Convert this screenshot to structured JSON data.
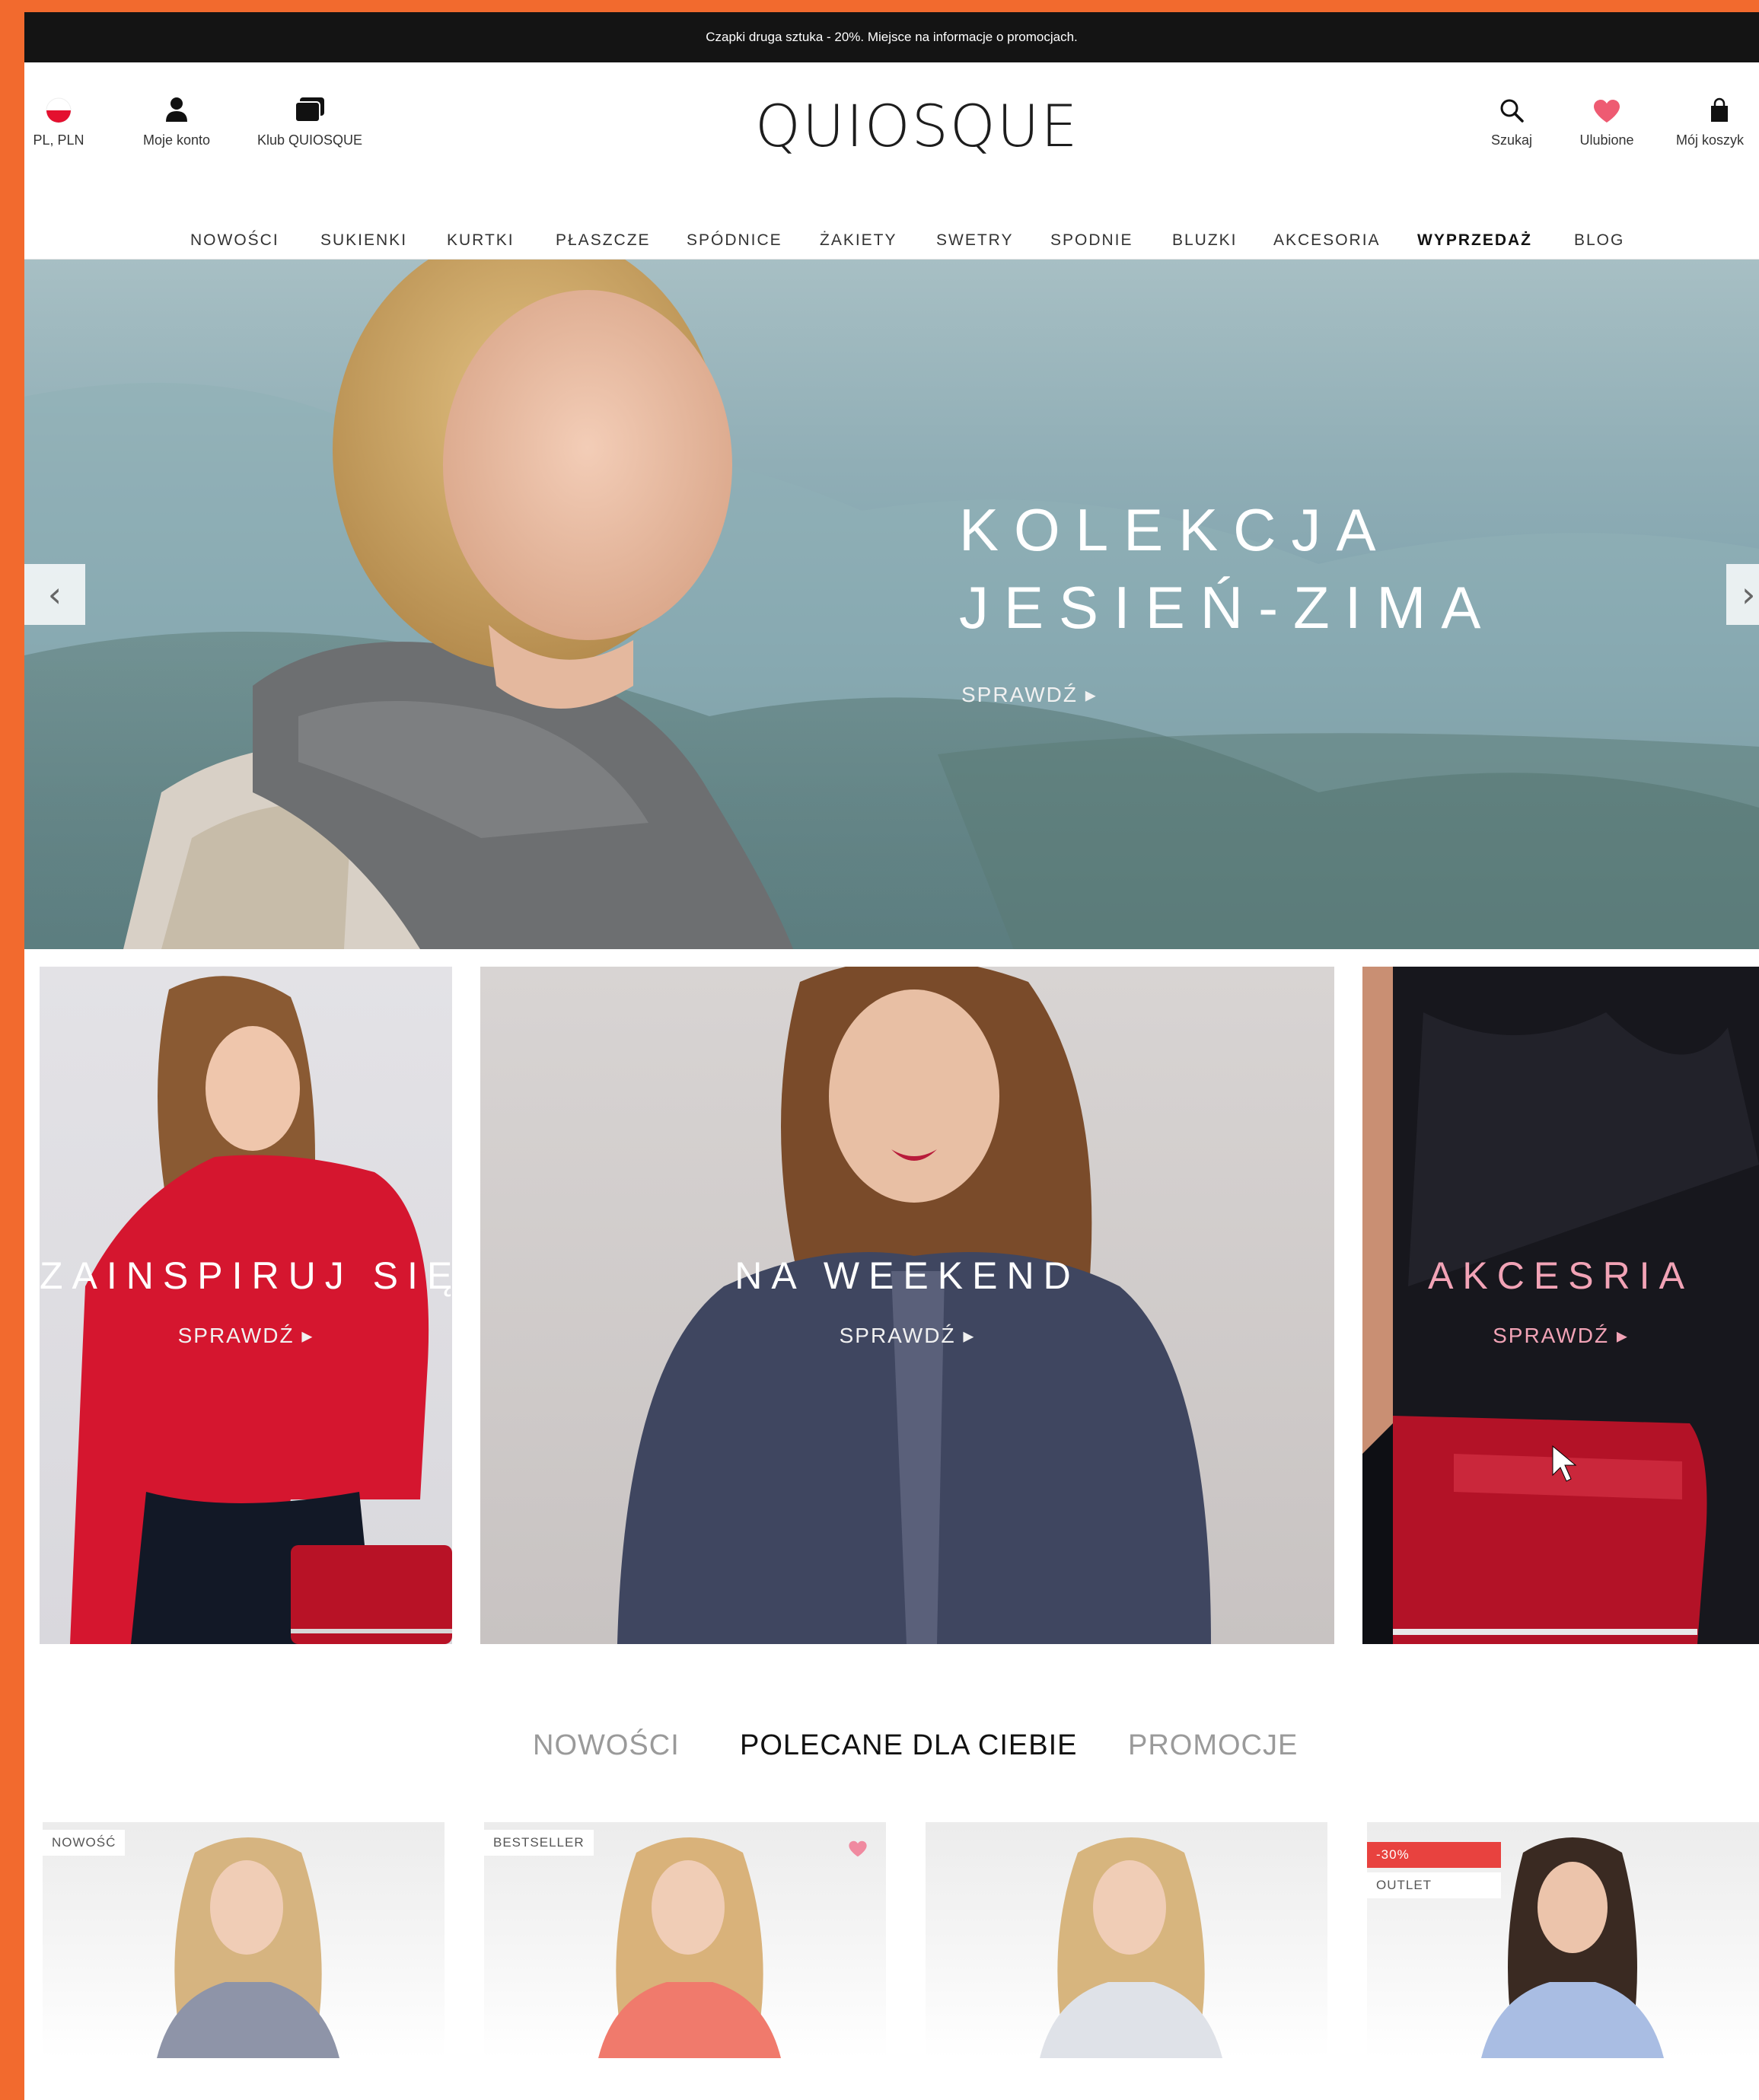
{
  "promo_bar": {
    "text": "Czapki druga sztuka - 20%. Miejsce na informacje o promocjach."
  },
  "header": {
    "locale": "PL, PLN",
    "account": "Moje konto",
    "club": "Klub QUIOSQUE",
    "logo": "QUIOSQUE",
    "search": "Szukaj",
    "favorites": "Ulubione",
    "cart": "Mój koszyk"
  },
  "nav": {
    "items": [
      "NOWOŚCI",
      "SUKIENKI",
      "KURTKI",
      "PŁASZCZE",
      "SPÓDNICE",
      "ŻAKIETY",
      "SWETRY",
      "SPODNIE",
      "BLUZKI",
      "AKCESORIA",
      "WYPRZEDAŻ",
      "BLOG"
    ]
  },
  "hero": {
    "title_line1": "KOLEKCJA",
    "title_line2": "JESIEŃ-ZIMA",
    "cta": "SPRAWDŹ ▸",
    "prev_symbol": "‹",
    "next_symbol": "›"
  },
  "tiles": [
    {
      "title": "ZAINSPIRUJ SIĘ",
      "cta": "SPRAWDŹ ▸"
    },
    {
      "title": "NA WEEKEND",
      "cta": "SPRAWDŹ ▸"
    },
    {
      "title": "AKCESRIA",
      "cta": "SPRAWDŹ ▸"
    }
  ],
  "tabs": [
    {
      "label": "NOWOŚCI",
      "active": false
    },
    {
      "label": "POLECANE DLA CIEBIE",
      "active": true
    },
    {
      "label": "PROMOCJE",
      "active": false
    }
  ],
  "products": [
    {
      "badge": "NOWOŚĆ"
    },
    {
      "badge": "BESTSELLER"
    },
    {
      "badge": ""
    },
    {
      "discount": "-30%",
      "badge": "OUTLET"
    }
  ],
  "colors": {
    "frame": "#f26a2e",
    "promo_bg": "#141414",
    "heart": "#ee5b72",
    "accent_pink": "#f2a3b6",
    "discount_red": "#e8423f"
  }
}
